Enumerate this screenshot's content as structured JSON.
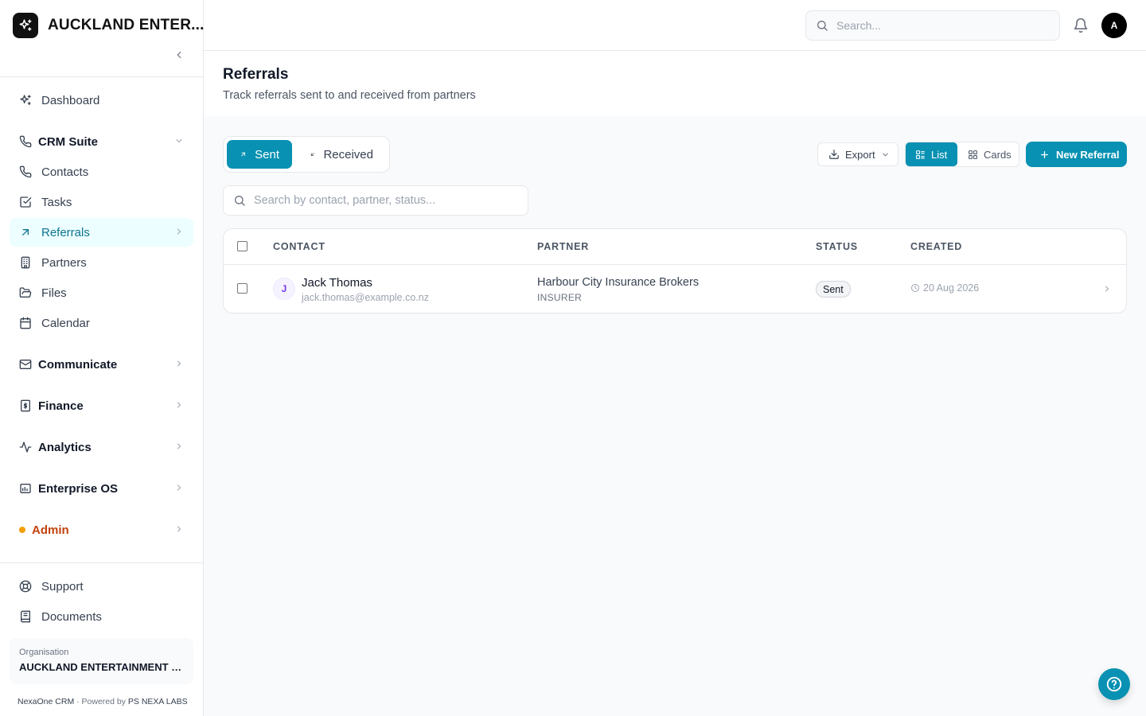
{
  "brand": {
    "name": "AUCKLAND ENTER..."
  },
  "sidebar": {
    "dashboard": "Dashboard",
    "crm_suite": "CRM Suite",
    "contacts": "Contacts",
    "tasks": "Tasks",
    "referrals": "Referrals",
    "partners": "Partners",
    "files": "Files",
    "calendar": "Calendar",
    "communicate": "Communicate",
    "finance": "Finance",
    "analytics": "Analytics",
    "enterprise_os": "Enterprise OS",
    "admin": "Admin",
    "support": "Support",
    "documents": "Documents",
    "org_label": "Organisation",
    "org_name": "AUCKLAND ENTERTAINMENT CO...",
    "footer_app": "NexaOne CRM",
    "footer_sep": "·",
    "footer_powered": "Powered by",
    "footer_company": "PS NEXA LABS"
  },
  "topbar": {
    "search_placeholder": "Search...",
    "avatar_initial": "A"
  },
  "page": {
    "title": "Referrals",
    "subtitle": "Track referrals sent to and received from partners"
  },
  "tabs": {
    "sent": "Sent",
    "received": "Received"
  },
  "toolbar": {
    "export": "Export",
    "list": "List",
    "cards": "Cards",
    "new_referral": "New Referral"
  },
  "filter": {
    "placeholder": "Search by contact, partner, status..."
  },
  "table": {
    "headers": {
      "contact": "CONTACT",
      "partner": "PARTNER",
      "status": "STATUS",
      "created": "CREATED"
    },
    "rows": [
      {
        "initial": "J",
        "name": "Jack Thomas",
        "email": "jack.thomas@example.co.nz",
        "partner": "Harbour City Insurance Brokers",
        "partner_type": "INSURER",
        "status": "Sent",
        "created": "20 Aug 2026"
      }
    ]
  },
  "colors": {
    "accent": "#0891b2",
    "admin": "#c2410c",
    "admin_dot": "#f59e0b"
  }
}
